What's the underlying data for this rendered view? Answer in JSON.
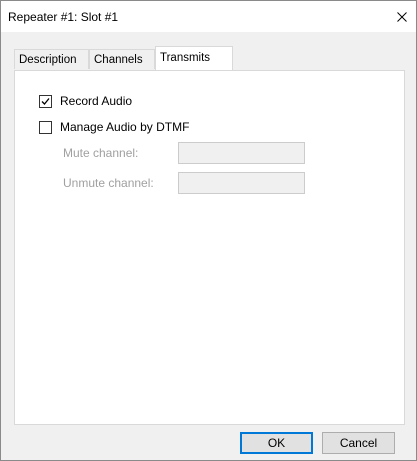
{
  "window": {
    "title": "Repeater #1: Slot #1",
    "close_glyph": "close-icon"
  },
  "tabs": [
    {
      "label": "Description",
      "active": false
    },
    {
      "label": "Channels",
      "active": false
    },
    {
      "label": "Transmits",
      "active": true
    }
  ],
  "transmits": {
    "record_audio": {
      "label": "Record Audio",
      "checked": true
    },
    "manage_audio_dtmf": {
      "label": "Manage Audio by DTMF",
      "checked": false
    },
    "mute_channel": {
      "label": "Mute channel:",
      "value": "",
      "enabled": false
    },
    "unmute_channel": {
      "label": "Unmute channel:",
      "value": "",
      "enabled": false
    }
  },
  "buttons": {
    "ok_label": "OK",
    "cancel_label": "Cancel"
  },
  "colors": {
    "accent": "#0078d7",
    "disabled_text": "#a0a0a0",
    "panel_bg": "#ffffff",
    "dialog_bg": "#f0f0f0"
  }
}
